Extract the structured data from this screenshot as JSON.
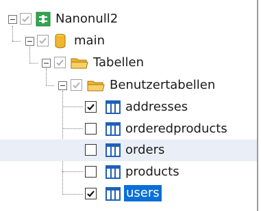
{
  "tree": {
    "nodes": [
      {
        "label": "Nanonull2",
        "level": 0,
        "icon": "server-icon",
        "expanded": true,
        "checked": true
      },
      {
        "label": "main",
        "level": 1,
        "icon": "database-cylinder-icon",
        "expanded": true,
        "checked": true
      },
      {
        "label": "Tabellen",
        "level": 2,
        "icon": "folder-icon",
        "expanded": true,
        "checked": true
      },
      {
        "label": "Benutzertabellen",
        "level": 3,
        "icon": "folder-icon",
        "expanded": true,
        "checked": true
      },
      {
        "label": "addresses",
        "level": 4,
        "icon": "table-icon",
        "checked": true
      },
      {
        "label": "orderedproducts",
        "level": 4,
        "icon": "table-icon",
        "checked": false
      },
      {
        "label": "orders",
        "level": 4,
        "icon": "table-icon",
        "checked": false,
        "hovered": true
      },
      {
        "label": "products",
        "level": 4,
        "icon": "table-icon",
        "checked": false
      },
      {
        "label": "users",
        "level": 4,
        "icon": "table-icon",
        "checked": true,
        "selected": true
      }
    ]
  },
  "colors": {
    "selection": "#0a6fd6",
    "hover": "#e9eef7",
    "table_icon": "#1f5fb8",
    "folder": "#f2b530",
    "server": "#2fa84f"
  }
}
